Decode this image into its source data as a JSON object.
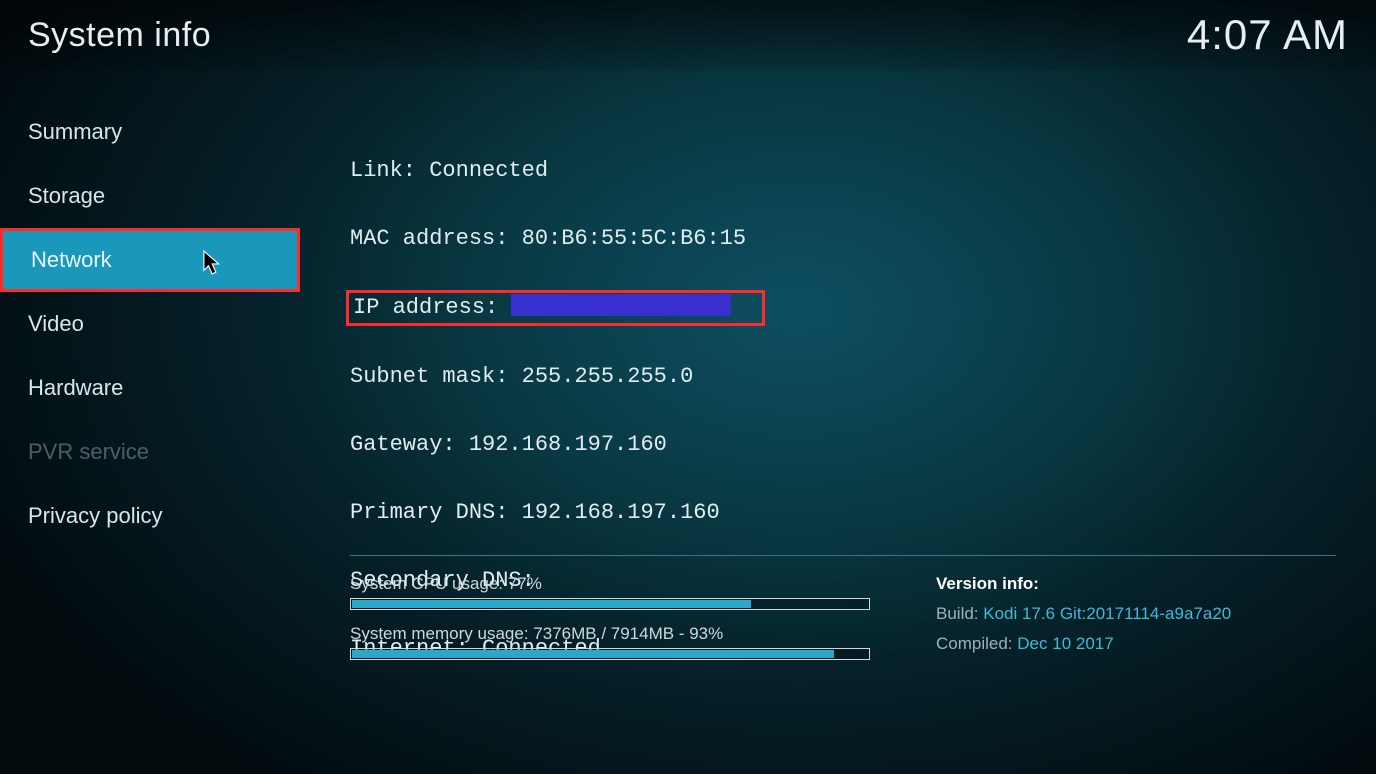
{
  "header": {
    "title": "System info",
    "clock": "4:07 AM"
  },
  "sidebar": {
    "items": [
      {
        "label": "Summary"
      },
      {
        "label": "Storage"
      },
      {
        "label": "Network",
        "selected": true
      },
      {
        "label": "Video"
      },
      {
        "label": "Hardware"
      },
      {
        "label": "PVR service",
        "disabled": true
      },
      {
        "label": "Privacy policy"
      }
    ]
  },
  "network": {
    "link_label": "Link:",
    "link_value": "Connected",
    "mac_label": "MAC address:",
    "mac_value": "80:B6:55:5C:B6:15",
    "ip_label": "IP address:",
    "subnet_label": "Subnet mask:",
    "subnet_value": "255.255.255.0",
    "gateway_label": "Gateway:",
    "gateway_value": "192.168.197.160",
    "pdns_label": "Primary DNS:",
    "pdns_value": "192.168.197.160",
    "sdns_label": "Secondary DNS:",
    "sdns_value": "",
    "internet_label": "Internet:",
    "internet_value": "Connected"
  },
  "footer": {
    "cpu_label": "System CPU usage: 77%",
    "cpu_pct": 77,
    "mem_label": "System memory usage: 7376MB / 7914MB - 93%",
    "mem_pct": 93,
    "version_title": "Version info:",
    "build_key": "Build:",
    "build_val": "Kodi 17.6 Git:20171114-a9a7a20",
    "compiled_key": "Compiled:",
    "compiled_val": "Dec 10 2017"
  }
}
